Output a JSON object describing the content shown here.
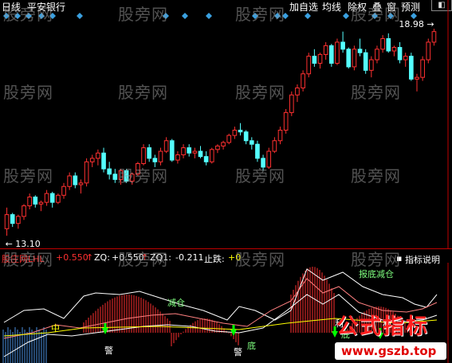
{
  "title": {
    "period": "日线",
    "stock": "平安银行"
  },
  "toolbar": [
    "加自选",
    "均线",
    "除权",
    "叠",
    "窗",
    "预测"
  ],
  "main_chart": {
    "high_label": "18.98",
    "low_label": "13.10",
    "candles": [
      [
        13.3,
        13.9,
        13.1,
        13.7
      ],
      [
        13.7,
        13.75,
        13.35,
        13.45
      ],
      [
        13.45,
        13.7,
        13.3,
        13.65
      ],
      [
        13.65,
        14.0,
        13.55,
        13.95
      ],
      [
        13.95,
        14.3,
        13.85,
        14.2
      ],
      [
        14.2,
        14.25,
        13.9,
        14.0
      ],
      [
        14.0,
        14.1,
        13.8,
        14.05
      ],
      [
        14.05,
        14.4,
        13.95,
        14.3
      ],
      [
        14.3,
        14.35,
        13.9,
        14.05
      ],
      [
        14.05,
        14.3,
        14.0,
        14.25
      ],
      [
        14.25,
        14.6,
        14.15,
        14.5
      ],
      [
        14.5,
        14.9,
        14.4,
        14.8
      ],
      [
        14.8,
        14.9,
        14.45,
        14.55
      ],
      [
        14.55,
        14.7,
        14.3,
        14.6
      ],
      [
        14.6,
        15.3,
        14.5,
        15.2
      ],
      [
        15.2,
        15.4,
        15.05,
        15.3
      ],
      [
        15.3,
        15.55,
        15.1,
        15.45
      ],
      [
        15.45,
        15.6,
        14.9,
        15.0
      ],
      [
        15.0,
        15.2,
        14.7,
        14.85
      ],
      [
        14.85,
        15.0,
        14.6,
        14.7
      ],
      [
        14.7,
        15.0,
        14.55,
        14.95
      ],
      [
        14.95,
        15.0,
        14.6,
        14.65
      ],
      [
        14.65,
        14.9,
        14.55,
        14.85
      ],
      [
        14.85,
        15.2,
        14.8,
        15.15
      ],
      [
        15.15,
        15.7,
        15.1,
        15.6
      ],
      [
        15.6,
        15.7,
        15.2,
        15.3
      ],
      [
        15.3,
        15.4,
        15.05,
        15.2
      ],
      [
        15.2,
        15.6,
        15.1,
        15.5
      ],
      [
        15.5,
        15.9,
        15.45,
        15.8
      ],
      [
        15.8,
        15.85,
        15.2,
        15.25
      ],
      [
        15.25,
        15.5,
        15.15,
        15.4
      ],
      [
        15.4,
        15.7,
        15.3,
        15.6
      ],
      [
        15.6,
        15.7,
        15.35,
        15.45
      ],
      [
        15.45,
        15.6,
        15.3,
        15.5
      ],
      [
        15.5,
        15.65,
        15.3,
        15.35
      ],
      [
        15.35,
        15.5,
        15.1,
        15.2
      ],
      [
        15.2,
        15.6,
        15.15,
        15.55
      ],
      [
        15.55,
        15.7,
        15.45,
        15.65
      ],
      [
        15.65,
        15.8,
        15.55,
        15.75
      ],
      [
        15.75,
        16.0,
        15.7,
        15.95
      ],
      [
        15.95,
        16.2,
        15.85,
        16.1
      ],
      [
        16.1,
        16.3,
        15.95,
        16.05
      ],
      [
        16.05,
        16.1,
        15.7,
        15.8
      ],
      [
        15.8,
        15.9,
        15.55,
        15.7
      ],
      [
        15.7,
        15.8,
        15.2,
        15.3
      ],
      [
        15.3,
        15.4,
        14.95,
        15.05
      ],
      [
        15.05,
        15.6,
        15.0,
        15.5
      ],
      [
        15.5,
        15.9,
        15.45,
        15.8
      ],
      [
        15.8,
        16.2,
        15.7,
        16.1
      ],
      [
        16.1,
        16.7,
        16.0,
        16.6
      ],
      [
        16.6,
        17.2,
        16.5,
        17.1
      ],
      [
        17.1,
        17.4,
        16.9,
        17.3
      ],
      [
        17.3,
        17.8,
        17.2,
        17.7
      ],
      [
        17.7,
        18.3,
        17.6,
        18.2
      ],
      [
        18.2,
        18.4,
        17.9,
        18.0
      ],
      [
        18.0,
        18.3,
        17.85,
        18.25
      ],
      [
        18.25,
        18.6,
        18.1,
        18.5
      ],
      [
        18.5,
        18.55,
        17.9,
        18.0
      ],
      [
        18.0,
        18.7,
        17.95,
        18.6
      ],
      [
        18.6,
        18.9,
        18.3,
        18.4
      ],
      [
        18.4,
        18.45,
        17.85,
        17.9
      ],
      [
        17.9,
        18.5,
        17.8,
        18.4
      ],
      [
        18.4,
        18.7,
        18.2,
        18.3
      ],
      [
        18.3,
        18.4,
        17.7,
        17.8
      ],
      [
        17.8,
        18.2,
        17.6,
        18.1
      ],
      [
        18.1,
        18.5,
        18.0,
        18.4
      ],
      [
        18.4,
        18.8,
        18.3,
        18.7
      ],
      [
        18.7,
        18.85,
        18.3,
        18.35
      ],
      [
        18.35,
        18.5,
        18.2,
        18.45
      ],
      [
        18.45,
        18.6,
        18.0,
        18.1
      ],
      [
        18.1,
        18.3,
        17.9,
        18.2
      ],
      [
        18.2,
        18.3,
        17.5,
        17.55
      ],
      [
        17.55,
        17.7,
        17.2,
        17.6
      ],
      [
        17.6,
        18.2,
        17.5,
        18.1
      ],
      [
        18.1,
        18.7,
        18.0,
        18.6
      ],
      [
        18.6,
        18.98,
        18.5,
        18.9
      ]
    ],
    "price_range": [
      12.9,
      19.3
    ]
  },
  "indicator": {
    "name": "股庄网LHL",
    "val1": "+0.550",
    "zq_label": "ZQ:",
    "zq_value": "+0.550",
    "zq1_label": "ZQ1:",
    "zq1_value": "-0.211",
    "zd_label": "止跌:",
    "zd_value": "+0",
    "help_button": "指标说明",
    "annotations": [
      "减仓",
      "报底减仓",
      "中",
      "警",
      "警",
      "底",
      "底",
      "利",
      "利"
    ],
    "colors": {
      "red": "#ff3030",
      "yellow": "#ffff00",
      "green": "#00ff00",
      "magenta": "#ff00ff",
      "white": "#ffffff"
    }
  },
  "watermarks": [
    "股旁网",
    "股旁网",
    "股旁网",
    "股旁网",
    "股旁网",
    "股旁网",
    "股旁网",
    "股旁网",
    "股旁网",
    "股旁网",
    "股旁网",
    "股旁网",
    "股旁网",
    "股旁网",
    "股旁网",
    "股旁网"
  ],
  "brand": {
    "title": "公式指标",
    "url": "www.gszb.top"
  }
}
